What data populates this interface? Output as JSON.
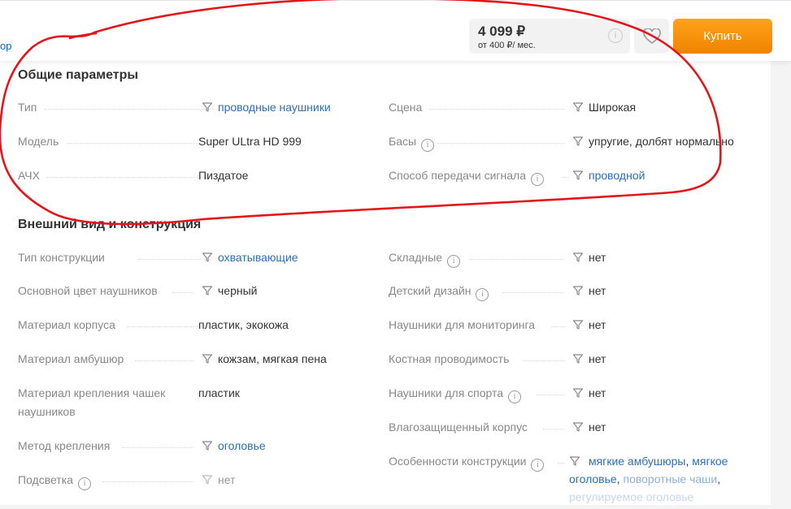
{
  "header": {
    "crumb": "ор",
    "price": "4 099 ₽",
    "credit": "от 400 ₽/ мес.",
    "buy_label": "Купить",
    "accent_color": "#f59a11",
    "wishlist_icon": "heart-icon"
  },
  "sections": {
    "general": {
      "title": "Общие параметры",
      "rows": [
        {
          "label": "Тип",
          "value": "проводные наушники"
        },
        {
          "label": "Модель",
          "value": "Super ULtra HD 999"
        },
        {
          "label": "АЧХ",
          "value": "Пиздатое"
        },
        {
          "label": "Сцена",
          "value": "Широкая"
        },
        {
          "label": "Басы",
          "value": "упругие, долбят нормально"
        },
        {
          "label": "Способ передачи сигнала",
          "value": "проводной"
        }
      ]
    },
    "design": {
      "title": "Внешний вид и конструкция",
      "rows": [
        {
          "label": "Тип конструкции",
          "value": "охватывающие"
        },
        {
          "label": "Основной цвет наушников",
          "value": "черный"
        },
        {
          "label": "Материал корпуса",
          "value": "пластик, экокожа"
        },
        {
          "label": "Материал амбушюр",
          "value": "кожзам, мягкая пена"
        },
        {
          "label": "Материал крепления чашек наушников",
          "value": "пластик"
        },
        {
          "label": "Метод крепления",
          "value": "оголовье"
        },
        {
          "label": "Подсветка",
          "value": "нет"
        },
        {
          "label": "Складные",
          "value": "нет"
        },
        {
          "label": "Детский дизайн",
          "value": "нет"
        },
        {
          "label": "Наушники для мониторинга",
          "value": "нет"
        },
        {
          "label": "Костная проводимость",
          "value": "нет"
        },
        {
          "label": "Наушники для спорта",
          "value": "нет"
        },
        {
          "label": "Влагозащищенный корпус",
          "value": "нет"
        },
        {
          "label": "Особенности конструкции",
          "values": [
            "мягкие амбушюры",
            "мягкое оголовье",
            "поворотные чаши",
            "регулируемое оголовье"
          ]
        }
      ]
    }
  },
  "icons": {
    "info": "i",
    "filter": "filter-icon"
  },
  "annotation_color": "#e3151a"
}
